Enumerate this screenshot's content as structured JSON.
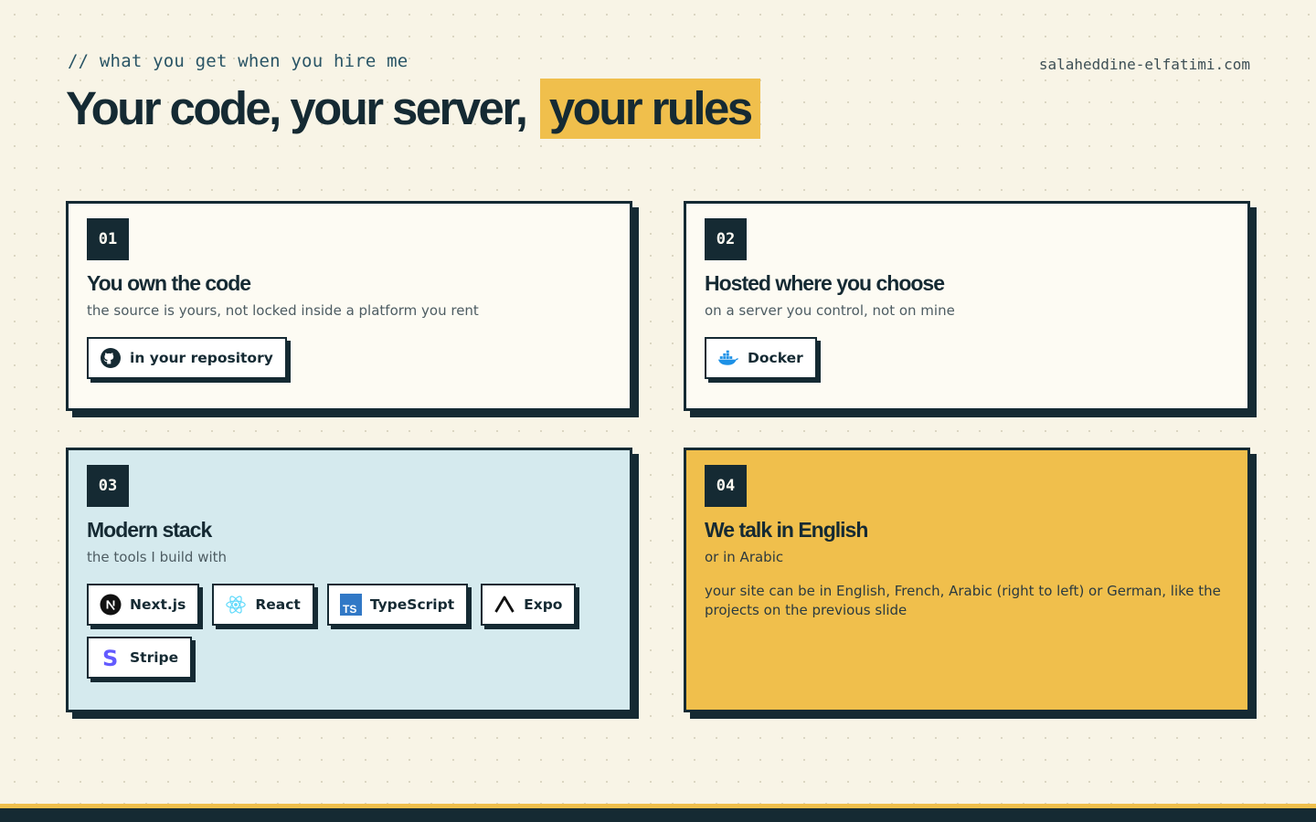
{
  "header": {
    "kicker": "// what you get when you hire me",
    "domain": "salaheddine-elfatimi.com",
    "title_main": "Your code, your server,",
    "title_highlight": "your rules"
  },
  "cards": [
    {
      "number": "01",
      "title": "You own the code",
      "subtitle": "the source is yours, not locked inside a platform you rent",
      "chips": [
        {
          "label": "in your repository",
          "icon": "github-icon"
        }
      ]
    },
    {
      "number": "02",
      "title": "Hosted where you choose",
      "subtitle": "on a server you control, not on mine",
      "chips": [
        {
          "label": "Docker",
          "icon": "docker-icon"
        }
      ]
    },
    {
      "number": "03",
      "title": "Modern stack",
      "subtitle": "the tools I build with",
      "chips": [
        {
          "label": "Next.js",
          "icon": "nextjs-icon"
        },
        {
          "label": "React",
          "icon": "react-icon"
        },
        {
          "label": "TypeScript",
          "icon": "typescript-icon"
        },
        {
          "label": "Expo",
          "icon": "expo-icon"
        },
        {
          "label": "Stripe",
          "icon": "stripe-icon"
        }
      ]
    },
    {
      "number": "04",
      "title": "We talk in English",
      "subtitle": "or in Arabic",
      "body": "your site can be in English, French, Arabic (right to left) or German, like the projects on the previous slide"
    }
  ],
  "colors": {
    "background": "#f8f4e6",
    "ink": "#152a33",
    "accent_yellow": "#f0bf4c",
    "card_light": "#fdfbf3",
    "card_blue": "#d5eaee"
  }
}
